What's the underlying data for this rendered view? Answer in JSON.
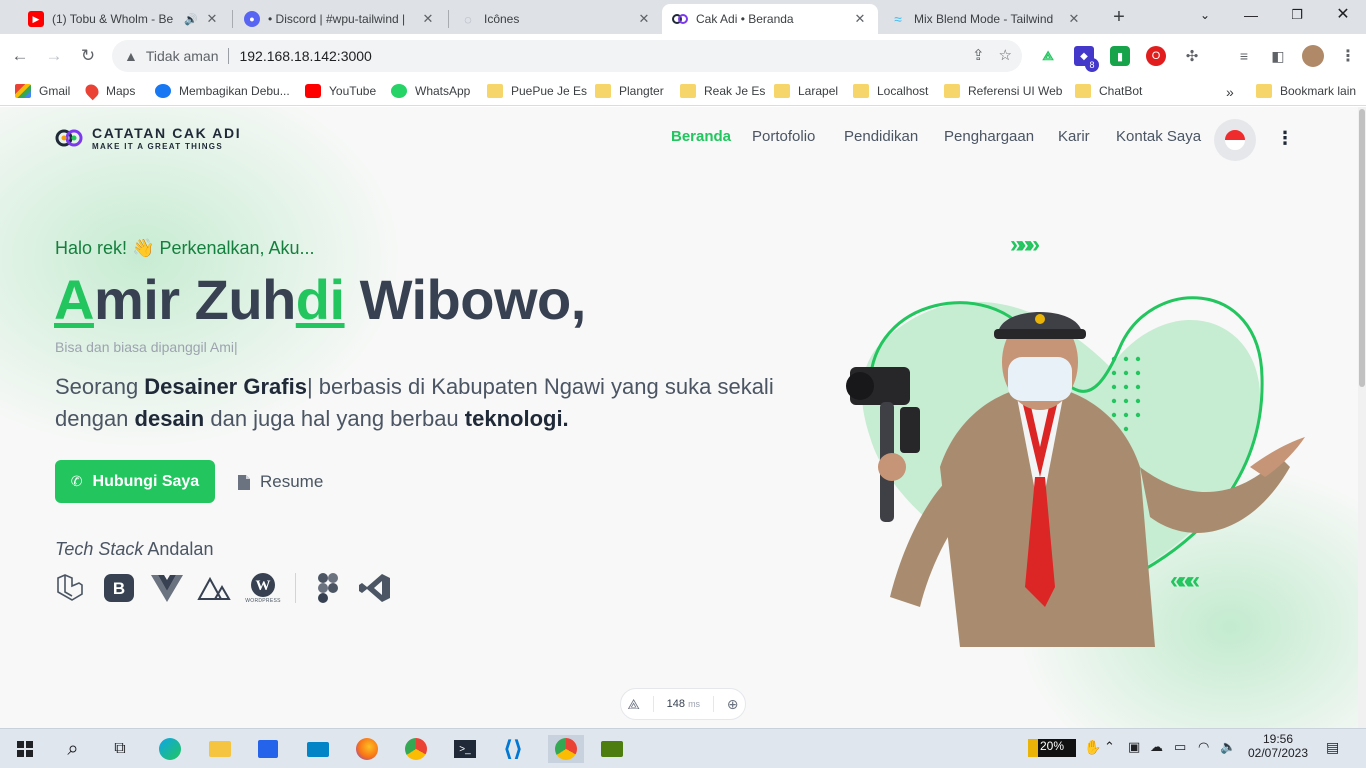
{
  "browser": {
    "tabs": [
      {
        "title": "(1) Tobu & Wholm - Be",
        "icon": "youtube-icon",
        "audio": true
      },
      {
        "title": "• Discord | #wpu-tailwind |",
        "icon": "discord-icon"
      },
      {
        "title": "Icônes",
        "icon": "icones-icon"
      },
      {
        "title": "Cak Adi • Beranda",
        "icon": "cak-adi-icon",
        "active": true
      },
      {
        "title": "Mix Blend Mode - Tailwind",
        "icon": "tailwind-icon"
      }
    ],
    "address": {
      "security": "Tidak aman",
      "url": "192.168.18.142:3000"
    },
    "bookmarks": [
      {
        "label": "Gmail",
        "icon": "gmail-icon"
      },
      {
        "label": "Maps",
        "icon": "maps-icon"
      },
      {
        "label": "Membagikan Debu...",
        "icon": "facebook-icon"
      },
      {
        "label": "YouTube",
        "icon": "youtube-icon"
      },
      {
        "label": "WhatsApp",
        "icon": "whatsapp-icon"
      },
      {
        "label": "PuePue Je Es",
        "icon": "folder-icon"
      },
      {
        "label": "Plangter",
        "icon": "folder-icon"
      },
      {
        "label": "Reak Je Es",
        "icon": "folder-icon"
      },
      {
        "label": "Larapel",
        "icon": "folder-icon"
      },
      {
        "label": "Localhost",
        "icon": "folder-icon"
      },
      {
        "label": "Referensi UI Web",
        "icon": "folder-icon"
      },
      {
        "label": "ChatBot",
        "icon": "folder-icon"
      }
    ],
    "other_bookmarks": "Bookmark lain",
    "extension_badge": "8"
  },
  "site": {
    "logo_title": "CATATAN CAK ADI",
    "logo_subtitle": "MAKE IT A GREAT THINGS",
    "nav": [
      {
        "label": "Beranda",
        "active": true
      },
      {
        "label": "Portofolio"
      },
      {
        "label": "Pendidikan"
      },
      {
        "label": "Penghargaan"
      },
      {
        "label": "Karir"
      },
      {
        "label": "Kontak Saya"
      }
    ],
    "language_flag": "indonesia-flag-icon",
    "hero": {
      "greeting": "Halo rek! 👋 Perkenalkan, Aku...",
      "name_a": "A",
      "name_b": "mir Zuh",
      "name_c": "di",
      "name_d": " Wibowo,",
      "nickname": "Bisa dan biasa dipanggil Ami|",
      "desc_1": "Seorang ",
      "desc_2": "Desainer Grafis",
      "desc_3": "| berbasis di Kabupaten Ngawi yang suka sekali dengan ",
      "desc_4": "desain",
      "desc_5": " dan juga hal yang berbau ",
      "desc_6": "teknologi.",
      "cta_label": "Hubungi Saya",
      "resume_label": "Resume",
      "tech_label_italic": "Tech Stack",
      "tech_label_rest": " Andalan",
      "tech_stack": [
        "laravel-icon",
        "bootstrap-icon",
        "vue-icon",
        "nuxt-icon",
        "wordpress-icon",
        "figma-icon",
        "vscode-icon"
      ],
      "wordpress_caption": "WORDPRESS"
    },
    "dev_indicator": {
      "ms_value": "148",
      "ms_unit": "ms"
    },
    "accent_color": "#22c55e"
  },
  "taskbar": {
    "battery": "20%",
    "time": "19:56",
    "date": "02/07/2023"
  }
}
